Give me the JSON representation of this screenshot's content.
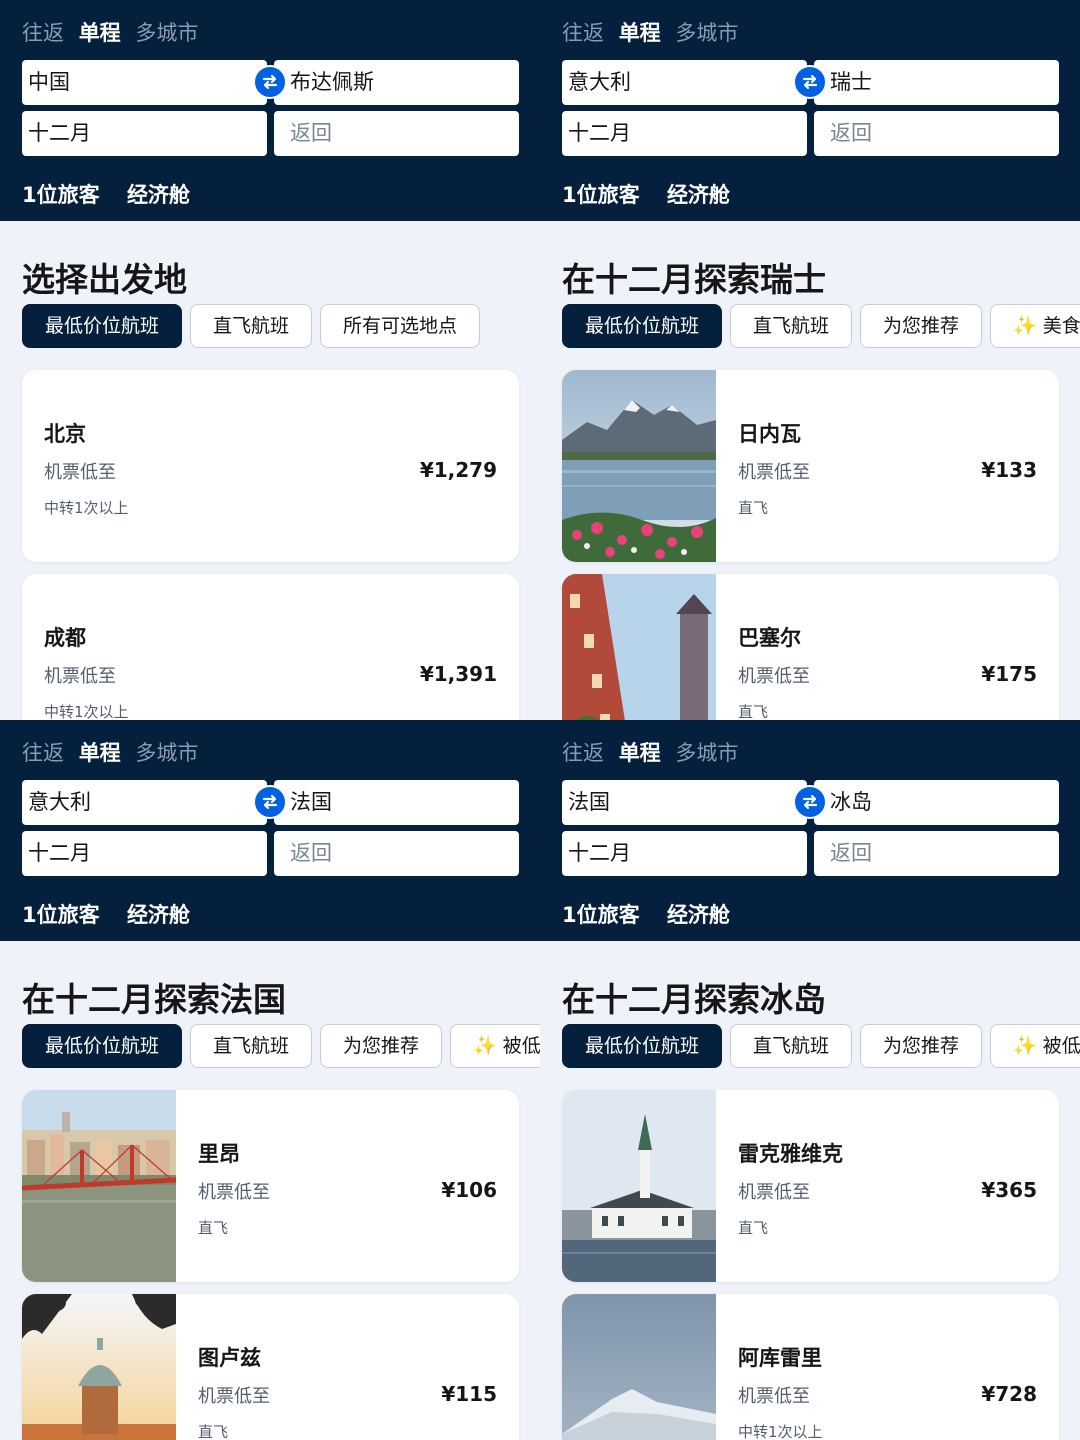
{
  "panels": [
    {
      "trip_tabs": [
        "往返",
        "单程",
        "多城市"
      ],
      "from": "中国",
      "to": "布达佩斯",
      "date": "十二月",
      "return_placeholder": "返回",
      "travellers": "1位旅客",
      "cabin": "经济舱",
      "title": "选择出发地",
      "chips": [
        "最低价位航班",
        "直飞航班",
        "所有可选地点"
      ],
      "cards": [
        {
          "city": "北京",
          "from_label": "机票低至",
          "price": "¥1,279",
          "stops": "中转1次以上"
        },
        {
          "city": "成都",
          "from_label": "机票低至",
          "price": "¥1,391",
          "stops": "中转1次以上"
        }
      ]
    },
    {
      "trip_tabs": [
        "往返",
        "单程",
        "多城市"
      ],
      "from": "意大利",
      "to": "瑞士",
      "date": "十二月",
      "return_placeholder": "返回",
      "travellers": "1位旅客",
      "cabin": "经济舱",
      "title": "在十二月探索瑞士",
      "chips": [
        "最低价位航班",
        "直飞航班",
        "为您推荐",
        "美食"
      ],
      "cards": [
        {
          "city": "日内瓦",
          "from_label": "机票低至",
          "price": "¥133",
          "stops": "直飞",
          "image": "lake-mountain"
        },
        {
          "city": "巴塞尔",
          "from_label": "机票低至",
          "price": "¥175",
          "stops": "直飞",
          "image": "city-buildings"
        }
      ]
    },
    {
      "trip_tabs": [
        "往返",
        "单程",
        "多城市"
      ],
      "from": "意大利",
      "to": "法国",
      "date": "十二月",
      "return_placeholder": "返回",
      "travellers": "1位旅客",
      "cabin": "经济舱",
      "title": "在十二月探索法国",
      "chips": [
        "最低价位航班",
        "直飞航班",
        "为您推荐",
        "被低"
      ],
      "cards": [
        {
          "city": "里昂",
          "from_label": "机票低至",
          "price": "¥106",
          "stops": "直飞",
          "image": "river-bridge"
        },
        {
          "city": "图卢兹",
          "from_label": "机票低至",
          "price": "¥115",
          "stops": "直飞",
          "image": "sunset-dome"
        }
      ]
    },
    {
      "trip_tabs": [
        "往返",
        "单程",
        "多城市"
      ],
      "from": "法国",
      "to": "冰岛",
      "date": "十二月",
      "return_placeholder": "返回",
      "travellers": "1位旅客",
      "cabin": "经济舱",
      "title": "在十二月探索冰岛",
      "chips": [
        "最低价位航班",
        "直飞航班",
        "为您推荐",
        "被低"
      ],
      "cards": [
        {
          "city": "雷克雅维克",
          "from_label": "机票低至",
          "price": "¥365",
          "stops": "直飞",
          "image": "church-harbor"
        },
        {
          "city": "阿库雷里",
          "from_label": "机票低至",
          "price": "¥728",
          "stops": "中转1次以上",
          "image": "snow-mountain-night"
        }
      ]
    }
  ],
  "active_trip_tab": 1,
  "active_chip": 0,
  "sparkle_chip": 3,
  "colors": {
    "header_bg": "#05203c",
    "accent": "#0062e3",
    "page_bg": "#eff2f9"
  }
}
